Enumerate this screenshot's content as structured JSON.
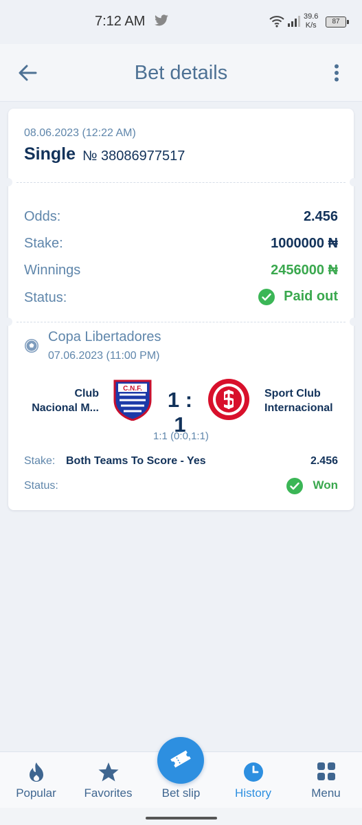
{
  "status_bar": {
    "time": "7:12 AM",
    "speed_value": "39.6",
    "speed_unit": "K/s",
    "battery": "87"
  },
  "header": {
    "title": "Bet details",
    "back_icon": "arrow-left-icon",
    "more_icon": "more-vertical-icon"
  },
  "bet": {
    "date": "08.06.2023 (12:22 AM)",
    "type": "Single",
    "number": "№ 38086977517",
    "summary": {
      "odds_label": "Odds:",
      "odds_value": "2.456",
      "stake_label": "Stake:",
      "stake_value": "1000000 ₦",
      "winnings_label": "Winnings",
      "winnings_value": "2456000 ₦",
      "status_label": "Status:",
      "status_value": "Paid out"
    },
    "event": {
      "league": "Copa Libertadores",
      "date": "07.06.2023 (11:00 PM)",
      "team_home_line1": "Club",
      "team_home_line2": "Nacional M...",
      "team_away_line1": "Sport Club",
      "team_away_line2": "Internacional",
      "score": "1 : 1",
      "score_detail": "1:1 (0:0,1:1)",
      "stake_label": "Stake:",
      "market": "Both Teams To Score - Yes",
      "odds": "2.456",
      "status_label": "Status:",
      "status_value": "Won"
    }
  },
  "nav": {
    "items": [
      {
        "label": "Popular",
        "icon": "flame-icon"
      },
      {
        "label": "Favorites",
        "icon": "star-icon"
      },
      {
        "label": "Bet slip",
        "icon": "ticket-icon"
      },
      {
        "label": "History",
        "icon": "clock-icon"
      },
      {
        "label": "Menu",
        "icon": "grid-icon"
      }
    ]
  },
  "colors": {
    "accent": "#2d8fe0",
    "success": "#3aa84e",
    "text_dark": "#12325a",
    "text_muted": "#5f86ab"
  }
}
